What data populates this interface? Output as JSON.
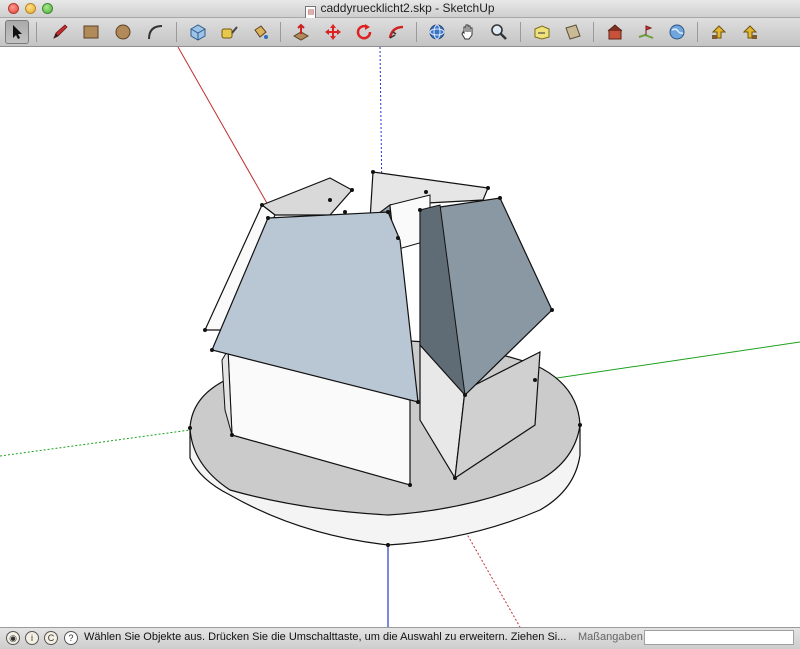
{
  "window": {
    "title": "caddyruecklicht2.skp - SketchUp"
  },
  "toolbar": {
    "tools": [
      {
        "name": "select-tool",
        "icon": "arrow-cursor-icon",
        "active": true
      },
      {
        "name": "pencil-tool",
        "icon": "pencil-icon"
      },
      {
        "name": "rectangle-tool",
        "icon": "rectangle-icon"
      },
      {
        "name": "circle-tool",
        "icon": "circle-icon"
      },
      {
        "name": "arc-tool",
        "icon": "arc-icon"
      },
      {
        "name": "make-component-tool",
        "icon": "component-icon"
      },
      {
        "name": "tape-measure-tool",
        "icon": "tape-measure-icon"
      },
      {
        "name": "paint-bucket-tool",
        "icon": "paint-bucket-icon"
      },
      {
        "name": "push-pull-tool",
        "icon": "push-pull-icon"
      },
      {
        "name": "move-tool",
        "icon": "move-icon"
      },
      {
        "name": "rotate-tool",
        "icon": "rotate-icon"
      },
      {
        "name": "follow-me-tool",
        "icon": "follow-me-icon"
      },
      {
        "name": "orbit-tool",
        "icon": "orbit-icon"
      },
      {
        "name": "pan-tool",
        "icon": "hand-icon"
      },
      {
        "name": "zoom-tool",
        "icon": "magnifier-icon"
      },
      {
        "name": "zoom-extents-tool",
        "icon": "zoom-extents-icon"
      },
      {
        "name": "section-plane-tool",
        "icon": "section-plane-icon"
      },
      {
        "name": "get-models-tool",
        "icon": "warehouse-icon"
      },
      {
        "name": "add-location-tool",
        "icon": "location-icon"
      },
      {
        "name": "toggle-terrain-tool",
        "icon": "globe-icon"
      },
      {
        "name": "previous-view-tool",
        "icon": "previous-view-icon"
      },
      {
        "name": "next-view-tool",
        "icon": "next-view-icon"
      }
    ]
  },
  "colors": {
    "face_light": "#f6f6f6",
    "face_roof_blue": "#b9c7d4",
    "face_roof_dark": "#8a98a4",
    "face_base_top": "#cbcbcb",
    "axis_red": "#c23030",
    "axis_green": "#1da01d",
    "axis_blue": "#2a35c8"
  },
  "status": {
    "message": "Wählen Sie Objekte aus. Drücken Sie die Umschalttaste, um die Auswahl zu erweitern. Ziehen Si...",
    "measurements_label": "Maßangaben",
    "measurements_value": ""
  }
}
